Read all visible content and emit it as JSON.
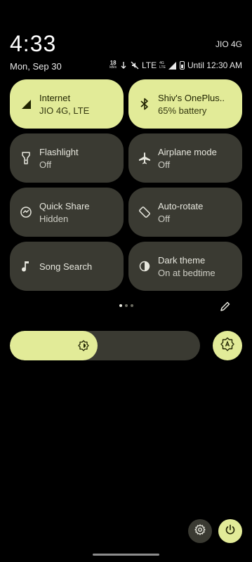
{
  "status": {
    "time": "4:33",
    "carrier": "JIO 4G",
    "date": "Mon, Sep 30",
    "speed_value": "18",
    "speed_unit": "kB/s",
    "network": "LTE",
    "lte_small_top": "4G",
    "lte_small_bottom": "LTE",
    "alarm_text": "Until 12:30 AM"
  },
  "tiles": [
    {
      "title": "Internet",
      "subtitle": "JIO 4G, LTE",
      "icon": "signal-icon",
      "active": true
    },
    {
      "title": "Shiv's OnePlus..",
      "subtitle": "65% battery",
      "icon": "bluetooth-icon",
      "active": true
    },
    {
      "title": "Flashlight",
      "subtitle": "Off",
      "icon": "flashlight-icon",
      "active": false
    },
    {
      "title": "Airplane mode",
      "subtitle": "Off",
      "icon": "airplane-icon",
      "active": false
    },
    {
      "title": "Quick Share",
      "subtitle": "Hidden",
      "icon": "quick-share-icon",
      "active": false
    },
    {
      "title": "Auto-rotate",
      "subtitle": "Off",
      "icon": "rotate-icon",
      "active": false
    },
    {
      "title": "Song Search",
      "subtitle": "",
      "icon": "music-note-icon",
      "active": false
    },
    {
      "title": "Dark theme",
      "subtitle": "On at bedtime",
      "icon": "dark-theme-icon",
      "active": false
    }
  ],
  "pager": {
    "count": 3,
    "current": 1
  },
  "brightness": {
    "level": 0.46
  },
  "colors": {
    "accent": "#e2eb98",
    "tile_inactive": "#3a3a32",
    "background": "#000000"
  }
}
